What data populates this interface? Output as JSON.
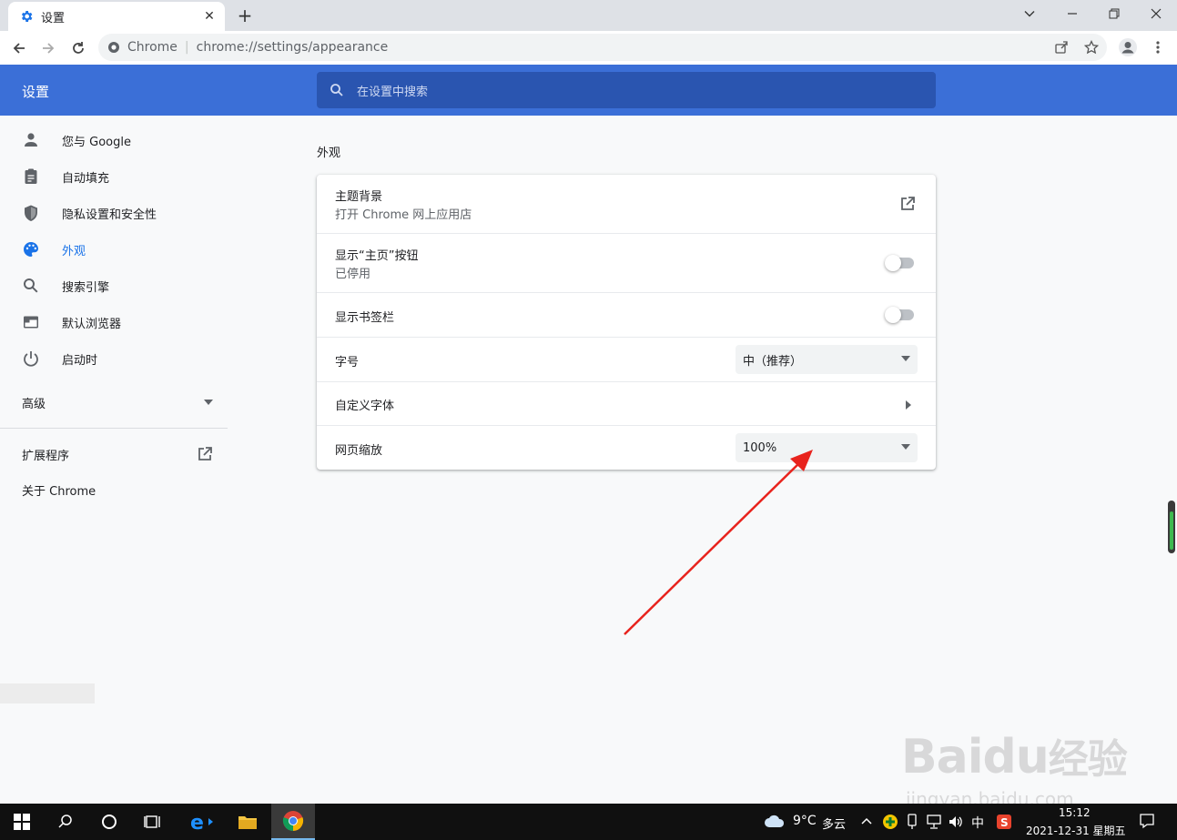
{
  "browser": {
    "tab_title": "设置",
    "tab_close": "✕",
    "new_tab": "+",
    "site_name": "Chrome",
    "url": "chrome://settings/appearance"
  },
  "header": {
    "title": "设置",
    "search_placeholder": "在设置中搜索"
  },
  "sidebar": {
    "items": [
      {
        "label": "您与 Google",
        "icon": "person-icon"
      },
      {
        "label": "自动填充",
        "icon": "clipboard-icon"
      },
      {
        "label": "隐私设置和安全性",
        "icon": "shield-icon"
      },
      {
        "label": "外观",
        "icon": "palette-icon"
      },
      {
        "label": "搜索引擎",
        "icon": "search-icon"
      },
      {
        "label": "默认浏览器",
        "icon": "browser-icon"
      },
      {
        "label": "启动时",
        "icon": "power-icon"
      }
    ],
    "advanced": "高级",
    "extensions": "扩展程序",
    "about": "关于 Chrome"
  },
  "main": {
    "section_title": "外观",
    "theme_title": "主题背景",
    "theme_sub": "打开 Chrome 网上应用店",
    "home_title": "显示“主页”按钮",
    "home_sub": "已停用",
    "home_enabled": false,
    "bookmarks_title": "显示书签栏",
    "bookmarks_enabled": false,
    "font_size_label": "字号",
    "font_size_value": "中（推荐）",
    "custom_fonts_label": "自定义字体",
    "zoom_label": "网页缩放",
    "zoom_value": "100%"
  },
  "taskbar": {
    "weather_temp": "9°C",
    "weather_desc": "多云",
    "ime": "中",
    "time": "15:12",
    "date": "2021-12-31 星期五"
  },
  "watermark": {
    "brand": "Baidu",
    "product": "经验",
    "site": "jingyan.baidu.com"
  },
  "colors": {
    "accent": "#3b6fd7",
    "active_link": "#1a73e8",
    "arrow": "#e8231d"
  }
}
